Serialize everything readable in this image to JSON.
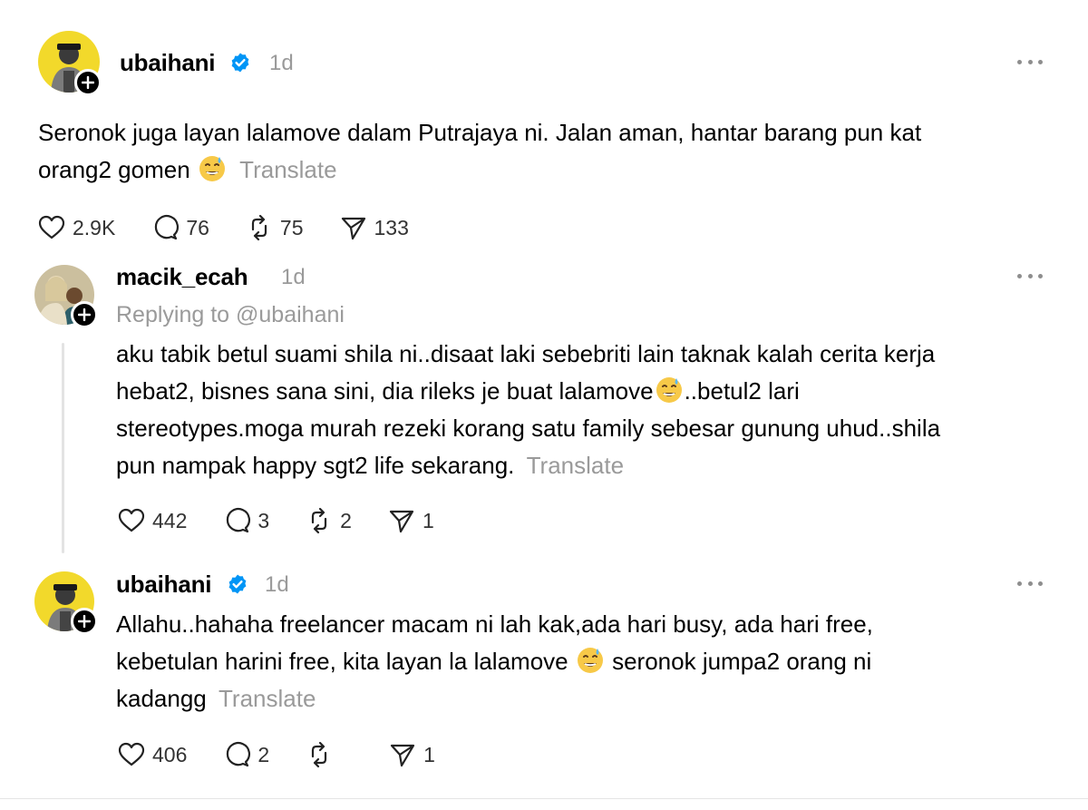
{
  "posts": [
    {
      "username": "ubaihani",
      "verified": true,
      "time": "1d",
      "text": "Seronok juga layan lalamove dalam Putrajaya ni. Jalan aman, hantar barang pun kat",
      "text2": "orang2 gomen",
      "emoji": "grinning-face-with-sweat",
      "translate": "Translate",
      "likes": "2.9K",
      "replies": "76",
      "reposts": "75",
      "shares": "133"
    },
    {
      "username": "macik_ecah",
      "time": "1d",
      "replying_to": "Replying to @ubaihani",
      "line1": "aku tabik betul suami shila ni..disaat laki sebebriti lain taknak kalah cerita kerja",
      "line2a": "hebat2, bisnes sana sini, dia rileks je buat lalamove",
      "line2b": "..betul2 lari",
      "line3": "stereotypes.moga murah rezeki korang satu family sebesar gunung uhud..shila",
      "line4": "pun nampak happy sgt2 life sekarang.",
      "translate": "Translate",
      "likes": "442",
      "replies": "3",
      "reposts": "2",
      "shares": "1"
    },
    {
      "username": "ubaihani",
      "verified": true,
      "time": "1d",
      "line1": "Allahu..hahaha freelancer macam ni lah kak,ada hari busy, ada hari free,",
      "line2a": "kebetulan harini free, kita layan la lalamove",
      "line2b": "seronok jumpa2 orang ni",
      "line3": "kadangg",
      "translate": "Translate",
      "likes": "406",
      "replies": "2",
      "reposts": "",
      "shares": "1"
    }
  ],
  "colors": {
    "verified": "#0095f6",
    "muted": "#9a9a9a",
    "avatar_yellow": "#f2d92b"
  }
}
